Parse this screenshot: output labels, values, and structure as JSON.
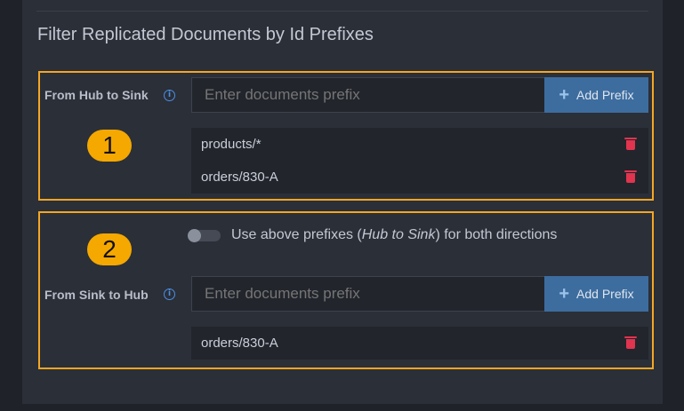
{
  "heading": "Filter Replicated Documents by Id Prefixes",
  "section1": {
    "badge": "1",
    "label": "From Hub to Sink",
    "info_icon": "i",
    "input_placeholder": "Enter documents prefix",
    "add_button_label": "Add Prefix",
    "prefixes": [
      "products/*",
      "orders/830-A"
    ]
  },
  "section2": {
    "badge": "2",
    "toggle": {
      "on": false,
      "text_before": "Use above prefixes (",
      "text_italic": "Hub to Sink",
      "text_after": ") for both directions"
    },
    "label": "From Sink to Hub",
    "info_icon": "i",
    "input_placeholder": "Enter documents prefix",
    "add_button_label": "Add Prefix",
    "prefixes": [
      "orders/830-A"
    ]
  },
  "colors": {
    "accent_frame": "#f5a623",
    "badge": "#f5a800",
    "add_button": "#3d6d9f",
    "delete_icon": "#e0344f",
    "info_icon": "#4a8fe3"
  },
  "icons": {
    "info": "info-icon",
    "add": "plus-icon",
    "delete": "trash-icon"
  }
}
